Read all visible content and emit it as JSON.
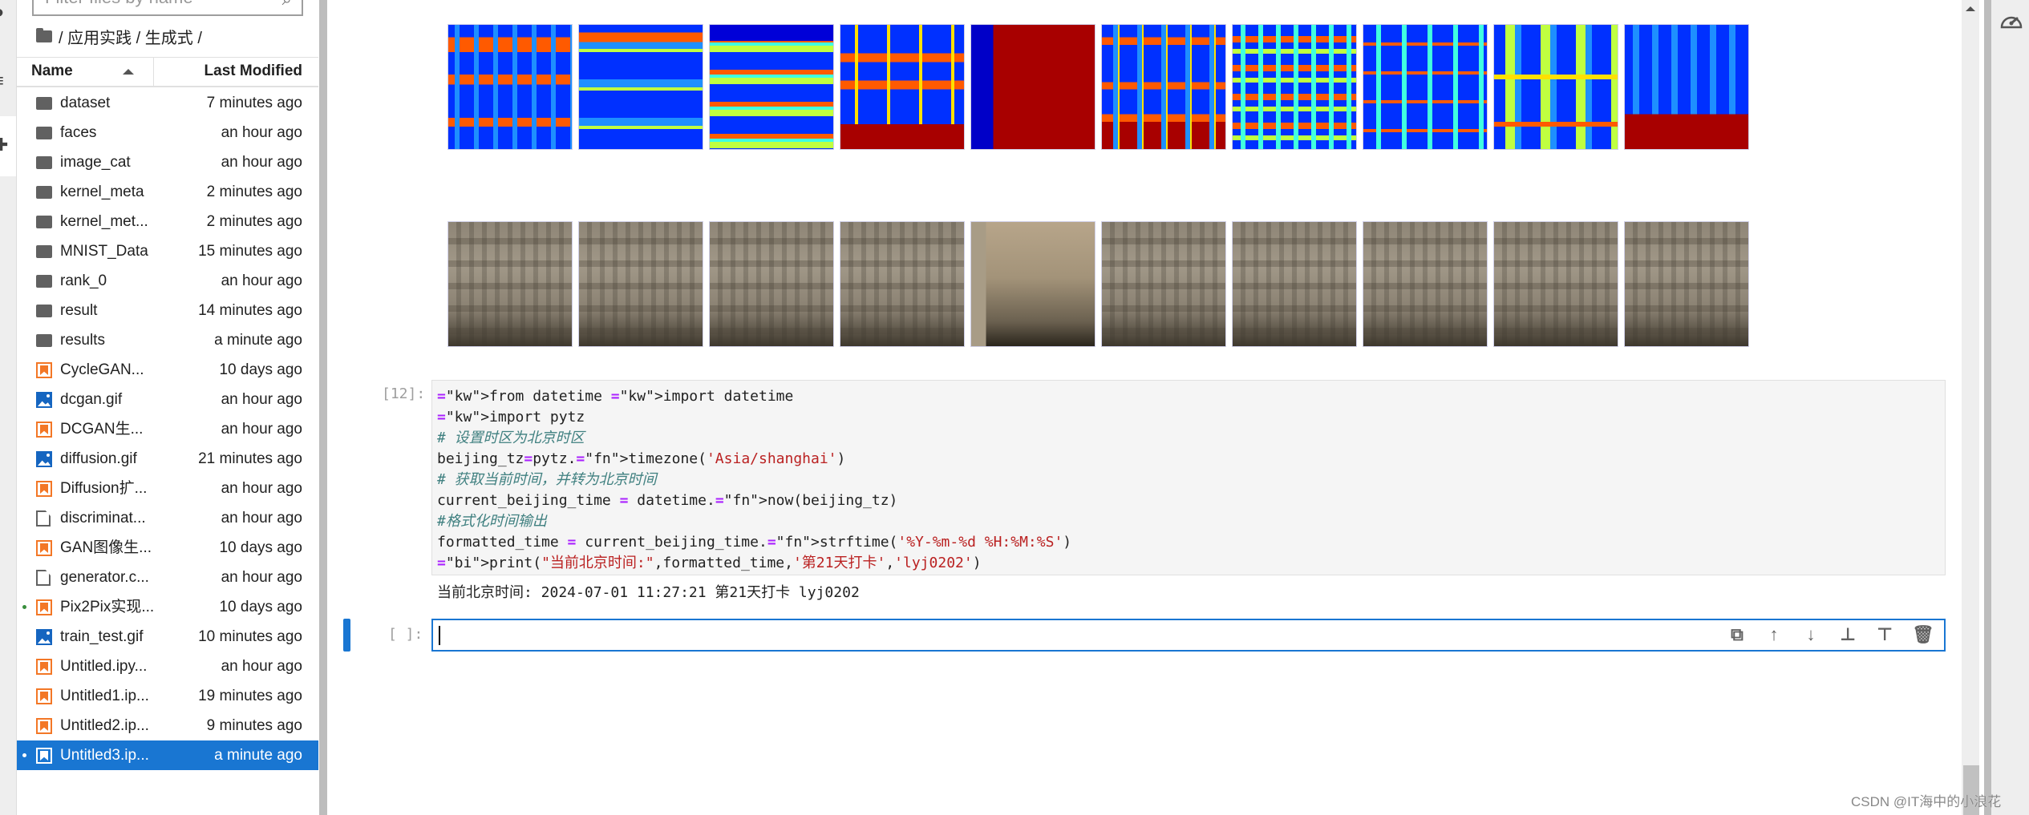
{
  "filebrowser": {
    "filter_placeholder": "Filter files by name",
    "breadcrumb": "/ 应用实践 / 生成式 /",
    "columns": {
      "name": "Name",
      "modified": "Last Modified"
    },
    "sort": "name-ascending",
    "files": [
      {
        "name": "dataset",
        "modified": "7 minutes ago",
        "type": "folder"
      },
      {
        "name": "faces",
        "modified": "an hour ago",
        "type": "folder"
      },
      {
        "name": "image_cat",
        "modified": "an hour ago",
        "type": "folder"
      },
      {
        "name": "kernel_meta",
        "modified": "2 minutes ago",
        "type": "folder"
      },
      {
        "name": "kernel_met...",
        "modified": "2 minutes ago",
        "type": "folder"
      },
      {
        "name": "MNIST_Data",
        "modified": "15 minutes ago",
        "type": "folder"
      },
      {
        "name": "rank_0",
        "modified": "an hour ago",
        "type": "folder"
      },
      {
        "name": "result",
        "modified": "14 minutes ago",
        "type": "folder"
      },
      {
        "name": "results",
        "modified": "a minute ago",
        "type": "folder"
      },
      {
        "name": "CycleGAN...",
        "modified": "10 days ago",
        "type": "notebook"
      },
      {
        "name": "dcgan.gif",
        "modified": "an hour ago",
        "type": "image"
      },
      {
        "name": "DCGAN生...",
        "modified": "an hour ago",
        "type": "notebook"
      },
      {
        "name": "diffusion.gif",
        "modified": "21 minutes ago",
        "type": "image"
      },
      {
        "name": "Diffusion扩...",
        "modified": "an hour ago",
        "type": "notebook"
      },
      {
        "name": "discriminat...",
        "modified": "an hour ago",
        "type": "file"
      },
      {
        "name": "GAN图像生...",
        "modified": "10 days ago",
        "type": "notebook"
      },
      {
        "name": "generator.c...",
        "modified": "an hour ago",
        "type": "file"
      },
      {
        "name": "Pix2Pix实现...",
        "modified": "10 days ago",
        "type": "notebook",
        "running": true
      },
      {
        "name": "train_test.gif",
        "modified": "10 minutes ago",
        "type": "image"
      },
      {
        "name": "Untitled.ipy...",
        "modified": "an hour ago",
        "type": "notebook"
      },
      {
        "name": "Untitled1.ip...",
        "modified": "19 minutes ago",
        "type": "notebook"
      },
      {
        "name": "Untitled2.ip...",
        "modified": "9 minutes ago",
        "type": "notebook"
      },
      {
        "name": "Untitled3.ip...",
        "modified": "a minute ago",
        "type": "notebook",
        "running": true,
        "selected": true
      }
    ]
  },
  "notebook": {
    "segmentation_tiles": [
      "a",
      "b",
      "c",
      "d",
      "e",
      "f",
      "g",
      "h",
      "i",
      "j"
    ],
    "photo_tiles": [
      "a",
      "b",
      "c",
      "d",
      "e",
      "f",
      "g",
      "h",
      "i",
      "j"
    ],
    "code_cell": {
      "prompt": "[12]:",
      "lines": [
        "from datetime import datetime",
        "import pytz",
        "# 设置时区为北京时区",
        "beijing_tz=pytz.timezone('Asia/shanghai')",
        "# 获取当前时间，并转为北京时间",
        "current_beijing_time = datetime.now(beijing_tz)",
        "#格式化时间输出",
        "formatted_time = current_beijing_time.strftime('%Y-%m-%d %H:%M:%S')",
        "print(\"当前北京时间:\",formatted_time,'第21天打卡','lyj0202')"
      ],
      "output": "当前北京时间: 2024-07-01 11:27:21 第21天打卡 lyj0202"
    },
    "empty_cell": {
      "prompt": "[ ]:",
      "value": ""
    },
    "cell_toolbar": [
      "duplicate-icon",
      "move-up-icon",
      "move-down-icon",
      "insert-above-icon",
      "insert-below-icon",
      "delete-icon"
    ]
  },
  "watermark": "CSDN @IT海中的小浪花",
  "colors": {
    "accent": "#1976d2",
    "notebook_icon": "#f37726",
    "image_icon": "#1565c0"
  }
}
